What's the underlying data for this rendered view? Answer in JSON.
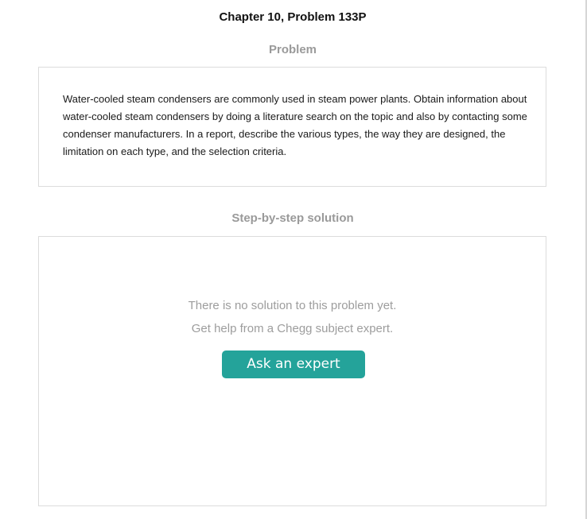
{
  "page": {
    "title": "Chapter 10, Problem 133P"
  },
  "problem": {
    "heading": "Problem",
    "text": "Water-cooled steam condensers are commonly used in steam power plants. Obtain information about water-cooled steam condensers by doing a literature search on the topic and also by contacting some condenser manufacturers. In a report, describe the various types, the way they are designed, the limitation on each type, and the selection criteria."
  },
  "solution": {
    "heading": "Step-by-step solution",
    "empty_message_line1": "There is no solution to this problem yet.",
    "empty_message_line2": "Get help from a Chegg subject expert.",
    "ask_button_label": "Ask an expert"
  },
  "colors": {
    "accent": "#24a39a",
    "heading_gray": "#9a9a9a",
    "border": "#dcdcdc"
  }
}
